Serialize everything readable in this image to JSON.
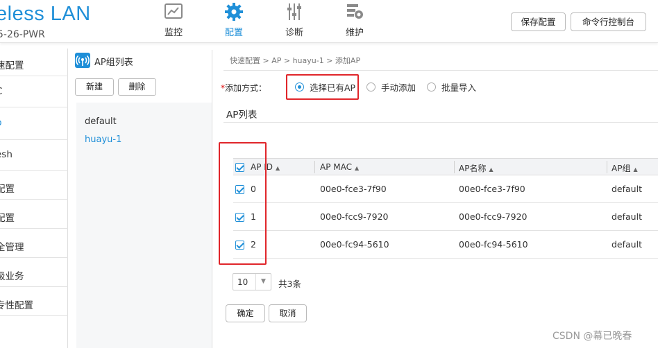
{
  "header": {
    "brand": "eless LAN",
    "model": "5-26-PWR",
    "nav": [
      {
        "label": "监控",
        "icon": "monitor-chart-icon"
      },
      {
        "label": "配置",
        "icon": "gear-icon"
      },
      {
        "label": "诊断",
        "icon": "sliders-icon"
      },
      {
        "label": "维护",
        "icon": "maintenance-icon"
      }
    ],
    "save_label": "保存配置",
    "cli_label": "命令行控制台"
  },
  "left_menu": {
    "items": [
      "速配置",
      "C",
      "p",
      "esh",
      "配置",
      "配置",
      "全管理",
      "级业务",
      "专性配置"
    ],
    "selected_index": 2
  },
  "ap_group_panel": {
    "title": "AP组列表",
    "new_label": "新建",
    "delete_label": "删除",
    "groups": [
      "default",
      "huayu-1"
    ],
    "selected_index": 1
  },
  "breadcrumb": "快速配置 > AP > huayu-1 > 添加AP",
  "add_method": {
    "required_mark": "*",
    "label": "添加方式：",
    "options": [
      "选择已有AP",
      "手动添加",
      "批量导入"
    ],
    "selected_index": 0
  },
  "section_title": "AP列表",
  "table": {
    "columns": [
      "AP ID",
      "AP MAC",
      "AP名称",
      "AP组"
    ],
    "rows": [
      {
        "id": "0",
        "mac": "00e0-fce3-7f90",
        "name": "00e0-fce3-7f90",
        "group": "default"
      },
      {
        "id": "1",
        "mac": "00e0-fcc9-7920",
        "name": "00e0-fcc9-7920",
        "group": "default"
      },
      {
        "id": "2",
        "mac": "00e0-fc94-5610",
        "name": "00e0-fc94-5610",
        "group": "default"
      }
    ]
  },
  "pager": {
    "page_size": "10",
    "total": "共3条"
  },
  "actions": {
    "ok_label": "确定",
    "cancel_label": "取消"
  },
  "watermark": "CSDN @幕已晚春",
  "colors": {
    "accent": "#1f8fd8",
    "highlight_box": "#e0252a"
  }
}
